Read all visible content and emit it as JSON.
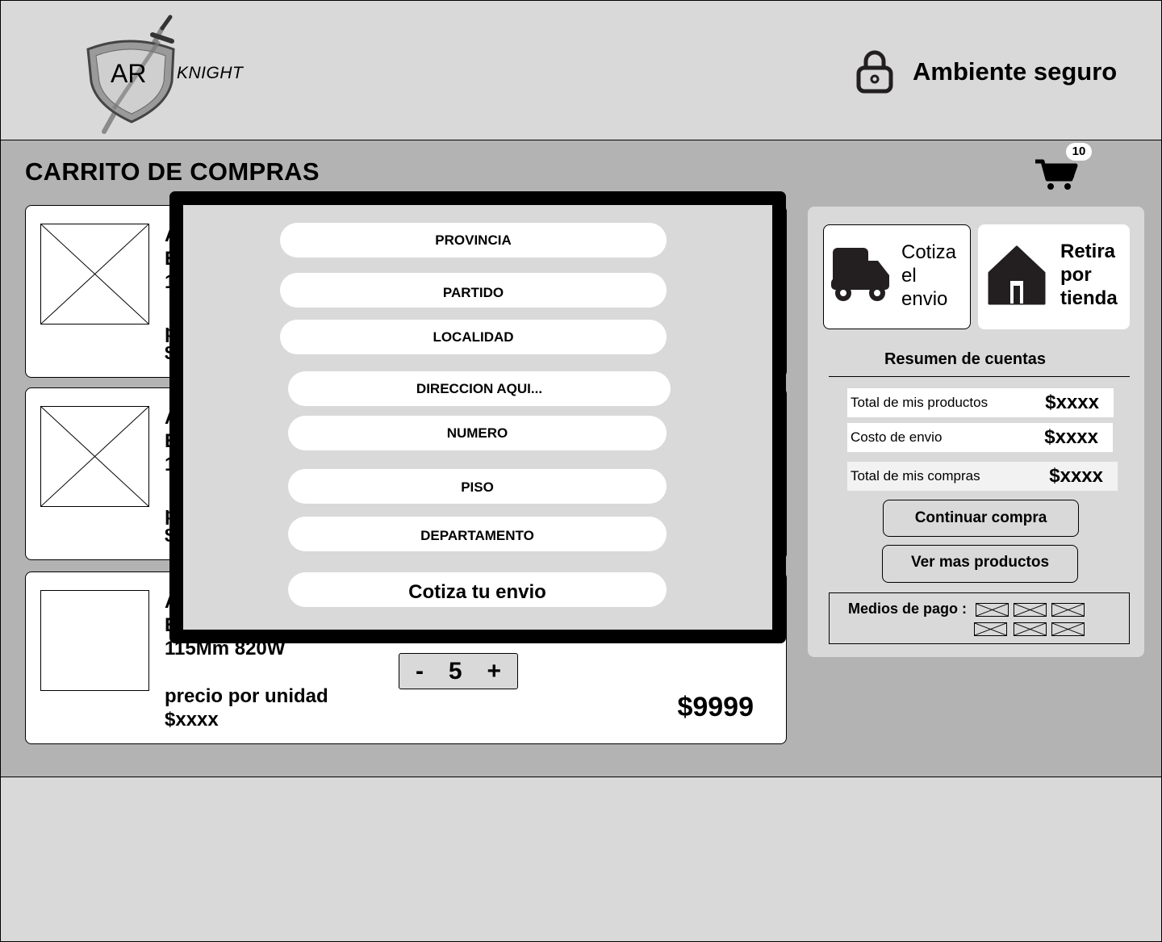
{
  "header": {
    "logo_initials": "AR",
    "logo_name": "KNIGHT",
    "secure_label": "Ambiente seguro",
    "secure_icon": "lock-icon"
  },
  "main": {
    "title": "CARRITO DE COMPRAS",
    "cart_icon": "cart-icon",
    "cart_count": "10"
  },
  "products": [
    {
      "line1": "A",
      "line2": "E",
      "line3": "1",
      "price_label": "p",
      "price": "$"
    },
    {
      "line1": "A",
      "line2": "E",
      "line3": "1",
      "price_label": "p",
      "price": "$"
    },
    {
      "line1": "A",
      "line2": "E",
      "line3": "115Mm 820W",
      "price_label": "precio por unidad",
      "price": "$xxxx",
      "quantity": "5",
      "minus": "-",
      "plus": "+",
      "total": "$9999"
    }
  ],
  "summary": {
    "quote_shipping_label": "Cotiza el envio",
    "quote_shipping_icon": "truck-icon",
    "pickup_label": "Retira por tienda",
    "pickup_icon": "home-icon",
    "title": "Resumen de cuentas",
    "rows": [
      {
        "label": "Total de mis productos",
        "value": "$xxxx"
      },
      {
        "label": "Costo de envio",
        "value": "$xxxx"
      },
      {
        "label": "Total de mis compras",
        "value": "$xxxx"
      }
    ],
    "continue_label": "Continuar compra",
    "more_label": "Ver mas productos",
    "payment_label": "Medios de pago :"
  },
  "modal": {
    "fields": [
      "PROVINCIA",
      "PARTIDO",
      "LOCALIDAD",
      "DIRECCION AQUI...",
      "NUMERO",
      "PISO",
      "DEPARTAMENTO"
    ],
    "submit_label": "Cotiza tu envio"
  },
  "colors": {
    "page_bg": "#d9d9d9",
    "main_bg": "#b3b3b3",
    "frame": "#000000",
    "card_bg": "#ffffff",
    "icon_dark": "#231f20"
  }
}
